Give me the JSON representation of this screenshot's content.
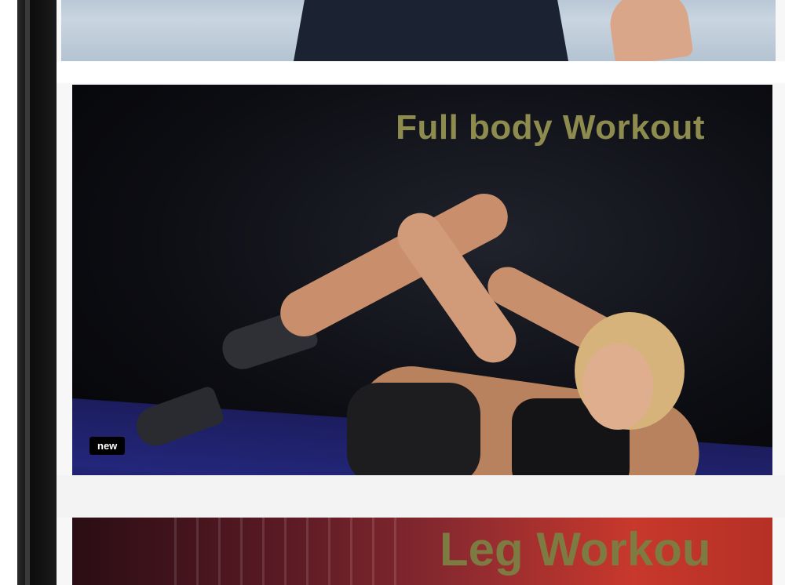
{
  "workouts": [
    {
      "title": "",
      "badge": ""
    },
    {
      "title": "Full body Workout",
      "badge": "new"
    },
    {
      "title": "Leg Workou",
      "badge": ""
    }
  ]
}
